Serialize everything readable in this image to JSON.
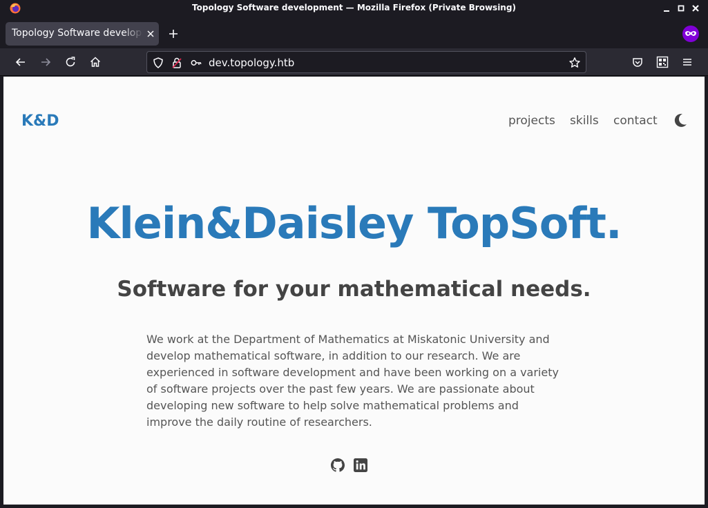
{
  "browser": {
    "window_title": "Topology Software development — Mozilla Firefox (Private Browsing)",
    "tab_title": "Topology Software development",
    "url": "dev.topology.htb",
    "private_icon": "private-browsing-mask-icon"
  },
  "site": {
    "brand": "K&D",
    "nav": [
      "projects",
      "skills",
      "contact"
    ],
    "theme_icon": "moon-icon",
    "hero_title": "Klein&Daisley TopSoft.",
    "hero_subtitle": "Software for your mathematical needs.",
    "about": "We work at the Department of Mathematics at Miskatonic University and develop mathematical software, in addition to our research. We are experienced in software development and have been working on a variety of software projects over the past few years. We are passionate about developing new software to help solve mathematical problems and improve the daily routine of researchers.",
    "social_icons": [
      "github-icon",
      "linkedin-icon"
    ]
  },
  "colors": {
    "accent": "#2a7ab9",
    "page_bg": "#fbfbfb",
    "chrome_bg": "#1c1b22",
    "toolbar_bg": "#2b2a33",
    "private_purple": "#8000d7"
  }
}
